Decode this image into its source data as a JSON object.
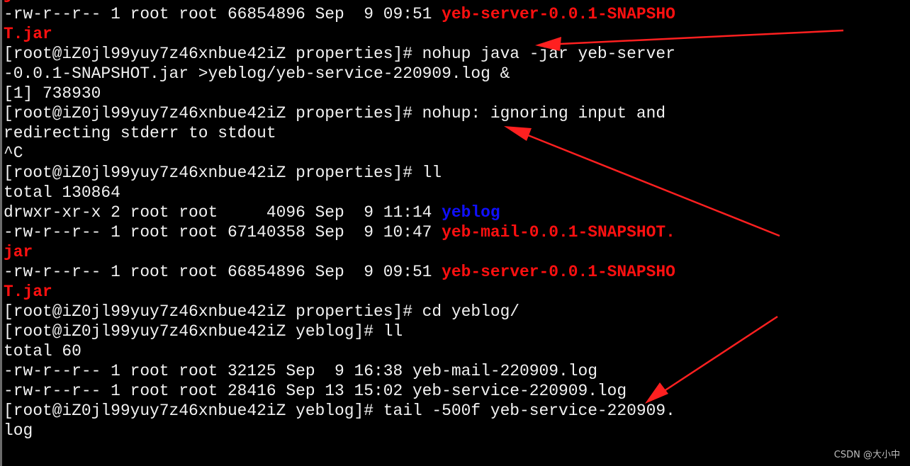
{
  "terminal": {
    "lines": [
      [
        {
          "t": "j",
          "c": "red"
        }
      ],
      [
        {
          "t": "-rw-r--r-- 1 root root 66854896 Sep  9 09:51 ",
          "c": ""
        },
        {
          "t": "yeb-server-0.0.1-SNAPSHO",
          "c": "red"
        }
      ],
      [
        {
          "t": "T.jar",
          "c": "red"
        }
      ],
      [
        {
          "t": "[root@iZ0jl99yuy7z46xnbue42iZ properties]# nohup java -jar yeb-server",
          "c": ""
        }
      ],
      [
        {
          "t": "-0.0.1-SNAPSHOT.jar >yeblog/yeb-service-220909.log &",
          "c": ""
        }
      ],
      [
        {
          "t": "[1] 738930",
          "c": ""
        }
      ],
      [
        {
          "t": "[root@iZ0jl99yuy7z46xnbue42iZ properties]# nohup: ignoring input and",
          "c": ""
        }
      ],
      [
        {
          "t": "redirecting stderr to stdout",
          "c": ""
        }
      ],
      [
        {
          "t": "^C",
          "c": ""
        }
      ],
      [
        {
          "t": "[root@iZ0jl99yuy7z46xnbue42iZ properties]# ll",
          "c": ""
        }
      ],
      [
        {
          "t": "total 130864",
          "c": ""
        }
      ],
      [
        {
          "t": "drwxr-xr-x 2 root root     4096 Sep  9 11:14 ",
          "c": ""
        },
        {
          "t": "yeblog",
          "c": "blue"
        }
      ],
      [
        {
          "t": "-rw-r--r-- 1 root root 67140358 Sep  9 10:47 ",
          "c": ""
        },
        {
          "t": "yeb-mail-0.0.1-SNAPSHOT.",
          "c": "red"
        }
      ],
      [
        {
          "t": "jar",
          "c": "red"
        }
      ],
      [
        {
          "t": "-rw-r--r-- 1 root root 66854896 Sep  9 09:51 ",
          "c": ""
        },
        {
          "t": "yeb-server-0.0.1-SNAPSHO",
          "c": "red"
        }
      ],
      [
        {
          "t": "T.jar",
          "c": "red"
        }
      ],
      [
        {
          "t": "[root@iZ0jl99yuy7z46xnbue42iZ properties]# cd yeblog/",
          "c": ""
        }
      ],
      [
        {
          "t": "[root@iZ0jl99yuy7z46xnbue42iZ yeblog]# ll",
          "c": ""
        }
      ],
      [
        {
          "t": "total 60",
          "c": ""
        }
      ],
      [
        {
          "t": "-rw-r--r-- 1 root root 32125 Sep  9 16:38 yeb-mail-220909.log",
          "c": ""
        }
      ],
      [
        {
          "t": "-rw-r--r-- 1 root root 28416 Sep 13 15:02 yeb-service-220909.log",
          "c": ""
        }
      ],
      [
        {
          "t": "[root@iZ0jl99yuy7z46xnbue42iZ yeblog]# tail -500f yeb-service-220909.",
          "c": ""
        }
      ],
      [
        {
          "t": "log",
          "c": ""
        }
      ]
    ]
  },
  "colors": {
    "background": "#000000",
    "text": "#f2f2f2",
    "jar": "#ff1010",
    "dir": "#1010ff",
    "annotation_arrow": "#ff2020"
  },
  "watermark": "CSDN @大小中"
}
